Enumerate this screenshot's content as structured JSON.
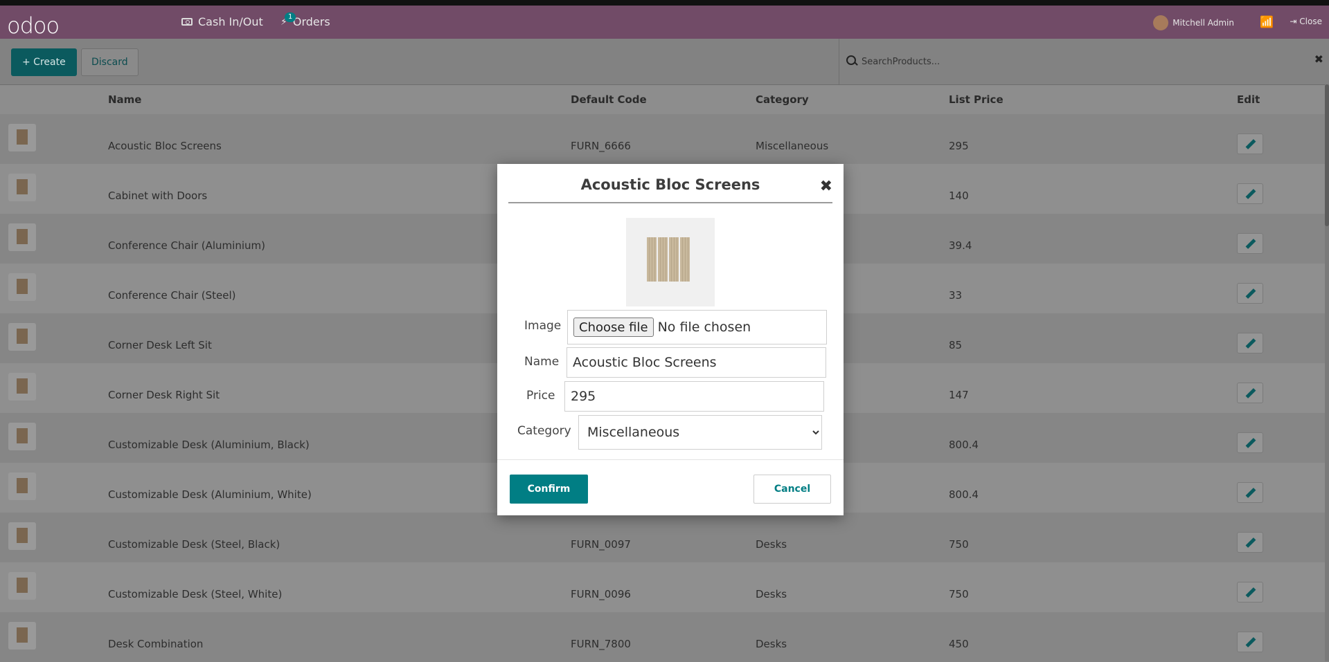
{
  "topbar": {
    "logo": "odoo",
    "cash_label": "Cash In/Out",
    "orders_label": "Orders",
    "orders_badge": "1",
    "user_name": "Mitchell Admin",
    "close_label": "Close"
  },
  "controls": {
    "create_label": "+ Create",
    "discard_label": "Discard",
    "search_placeholder": "SearchProducts..."
  },
  "table": {
    "headers": {
      "name": "Name",
      "code": "Default Code",
      "category": "Category",
      "price": "List Price",
      "edit": "Edit"
    },
    "rows": [
      {
        "name": "Acoustic Bloc Screens",
        "code": "FURN_6666",
        "category": "Miscellaneous",
        "price": "295"
      },
      {
        "name": "Cabinet with Doors",
        "code": "",
        "category": "",
        "price": "140"
      },
      {
        "name": "Conference Chair (Aluminium)",
        "code": "",
        "category": "",
        "price": "39.4"
      },
      {
        "name": "Conference Chair (Steel)",
        "code": "",
        "category": "",
        "price": "33"
      },
      {
        "name": "Corner Desk Left Sit",
        "code": "",
        "category": "",
        "price": "85"
      },
      {
        "name": "Corner Desk Right Sit",
        "code": "",
        "category": "",
        "price": "147"
      },
      {
        "name": "Customizable Desk (Aluminium, Black)",
        "code": "",
        "category": "",
        "price": "800.4"
      },
      {
        "name": "Customizable Desk (Aluminium, White)",
        "code": "",
        "category": "",
        "price": "800.4"
      },
      {
        "name": "Customizable Desk (Steel, Black)",
        "code": "FURN_0097",
        "category": "Desks",
        "price": "750"
      },
      {
        "name": "Customizable Desk (Steel, White)",
        "code": "FURN_0096",
        "category": "Desks",
        "price": "750"
      },
      {
        "name": "Desk Combination",
        "code": "FURN_7800",
        "category": "Desks",
        "price": "450"
      }
    ]
  },
  "modal": {
    "title": "Acoustic Bloc Screens",
    "image_label": "Image",
    "choose_file_label": "Choose file",
    "no_file_text": "No file chosen",
    "name_label": "Name",
    "name_value": "Acoustic Bloc Screens",
    "price_label": "Price",
    "price_value": "295",
    "category_label": "Category",
    "category_value": "Miscellaneous",
    "confirm_label": "Confirm",
    "cancel_label": "Cancel"
  },
  "colors": {
    "brand": "#714b67",
    "accent": "#017e84"
  }
}
